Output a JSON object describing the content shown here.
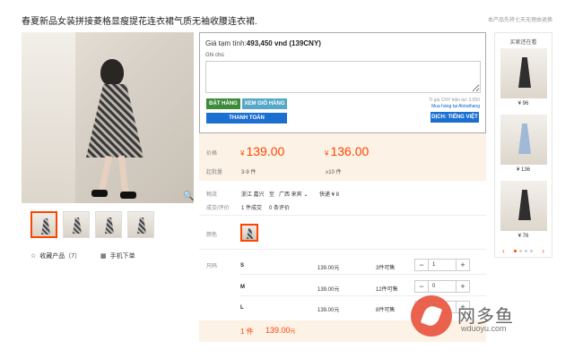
{
  "title": "春夏新品女装拼接菱格显瘦提花连衣裙气质无袖收腰连衣裙.",
  "top_note": "本产品先将七天无理由退换",
  "gallery": {
    "thumbs": [
      "thumb-1",
      "thumb-2",
      "thumb-3",
      "thumb-4"
    ],
    "favorite_label": "收藏产品（7）",
    "mobile_label": "手机下单"
  },
  "overlay": {
    "estimate_label": "Giá tạm tính:",
    "estimate_value": "493,450 vnd (139CNY)",
    "note_label": "Ghi chú",
    "rate_text": "Tỉ giá CNY hiện tại: 3,550",
    "rate_link": "Mua hàng tại Alotathang",
    "order_button": "ĐẶT HÀNG",
    "cart_button": "XEM GIỎ HÀNG",
    "pay_button": "THANH TOÁN",
    "translate_button": "DỊCH: TIẾNG VIỆT"
  },
  "pricing": {
    "price_label": "价格",
    "price1": "139.00",
    "price2": "136.00",
    "currency": "¥",
    "moq_label": "起批量",
    "moq1": "3-9 件",
    "moq2": "≥10 件"
  },
  "logistics": {
    "label": "物流",
    "from": "浙江 嘉兴",
    "to_prefix": "至",
    "to": "广西 来宾",
    "shipping": "快递 ¥ 8"
  },
  "deals": {
    "label": "成交/评价",
    "deals": "1 件成交",
    "reviews": "0 条评价"
  },
  "color": {
    "label": "颜色"
  },
  "sizes": {
    "label": "尺码",
    "rows": [
      {
        "size": "S",
        "price": "139.00元",
        "stock": "3件可售",
        "qty": "1"
      },
      {
        "size": "M",
        "price": "139.00元",
        "stock": "12件可售",
        "qty": "0"
      },
      {
        "size": "L",
        "price": "139.00元",
        "stock": "8件可售",
        "qty": "0"
      }
    ]
  },
  "total": {
    "count": "1 件",
    "amount": "139.00",
    "unit": "元"
  },
  "sidebar": {
    "title": "买家还在看",
    "items": [
      {
        "price": "¥ 96"
      },
      {
        "price": "¥ 136"
      },
      {
        "price": "¥ 76"
      }
    ]
  },
  "watermark": {
    "text": "网多鱼",
    "url": "wduoyu.com"
  }
}
